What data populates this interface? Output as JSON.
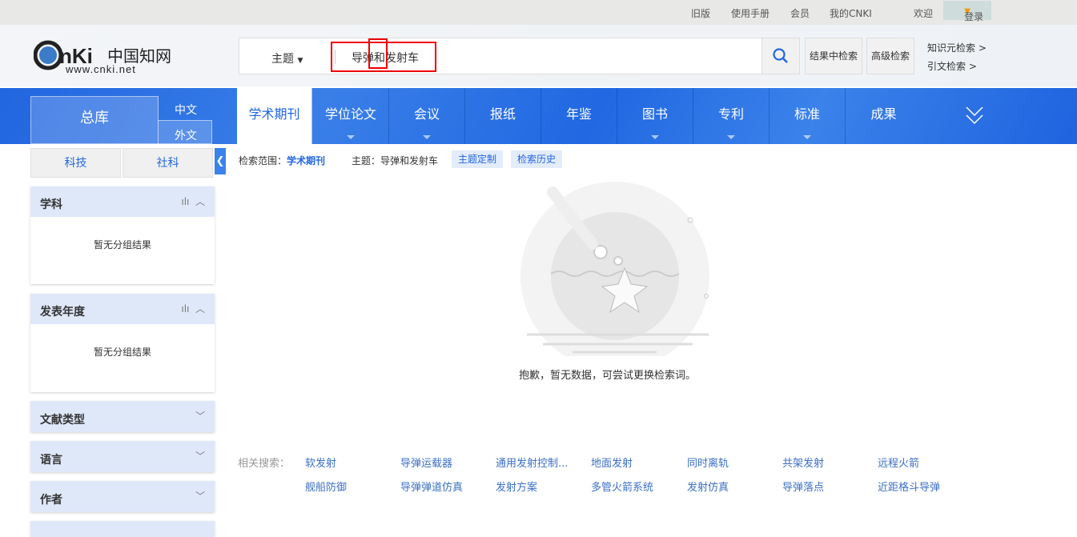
{
  "topbar": {
    "links": [
      "旧版",
      "使用手册",
      "会员",
      "我的CNKI"
    ],
    "welcome": "欢迎",
    "login": "登录"
  },
  "logo": {
    "text": "CNKI中国知网",
    "url": "www.cnki.net"
  },
  "search": {
    "type": "主题",
    "value": "导弹和发射车",
    "result_search": "结果中检索",
    "advanced": "高级检索",
    "knowledge": "知识元检索 >",
    "citation": "引文检索 >"
  },
  "nav": {
    "all": "总库",
    "zh": "中文",
    "foreign": "外文",
    "tabs": [
      "学术期刊",
      "学位论文",
      "会议",
      "报纸",
      "年鉴",
      "图书",
      "专利",
      "标准",
      "成果"
    ]
  },
  "subtabs": [
    "科技",
    "社科"
  ],
  "crumb": {
    "scope_label": "检索范围：",
    "scope": "学术期刊",
    "topic": "主题：导弹和发射车",
    "custom": "主题定制",
    "history": "检索历史"
  },
  "facets": [
    {
      "title": "学科",
      "empty": "暂无分组结果"
    },
    {
      "title": "发表年度",
      "empty": "暂无分组结果"
    },
    {
      "title": "文献类型"
    },
    {
      "title": "语言"
    },
    {
      "title": "作者"
    }
  ],
  "empty_message": "抱歉，暂无数据，可尝试更换检索词。",
  "related": {
    "label": "相关搜索：",
    "items": [
      "软发射",
      "导弹运载器",
      "通用发射控制...",
      "地面发射",
      "同时离轨",
      "共架发射",
      "远程火箭",
      "舰船防御",
      "导弹弹道仿真",
      "发射方案",
      "多管火箭系统",
      "发射仿真",
      "导弹落点",
      "近距格斗导弹"
    ]
  }
}
